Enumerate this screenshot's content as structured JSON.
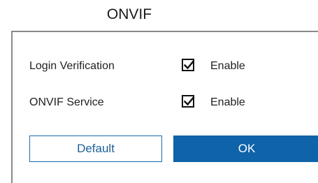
{
  "dialog": {
    "title": "ONVIF"
  },
  "settings": [
    {
      "label": "Login Verification",
      "checkbox_label": "Enable",
      "checked": true
    },
    {
      "label": "ONVIF Service",
      "checkbox_label": "Enable",
      "checked": true
    }
  ],
  "buttons": {
    "default_label": "Default",
    "ok_label": "OK"
  },
  "colors": {
    "accent": "#0f63a8",
    "border": "#8a8a8a",
    "text": "#222222"
  }
}
